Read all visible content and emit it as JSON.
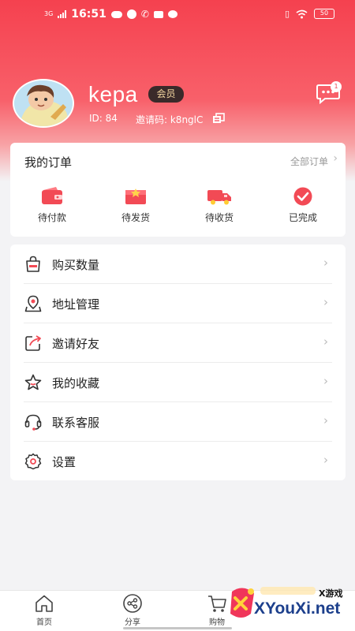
{
  "status_bar": {
    "network": "3G",
    "time": "16:51",
    "battery": "50"
  },
  "profile": {
    "username": "kepa",
    "badge": "会员",
    "id_label": "ID: 84",
    "invite_label": "邀请码: k8nglC",
    "message_count": "1"
  },
  "orders": {
    "title": "我的订单",
    "all_label": "全部订单",
    "items": [
      {
        "label": "待付款",
        "icon": "wallet-icon"
      },
      {
        "label": "待发货",
        "icon": "gift-box-icon"
      },
      {
        "label": "待收货",
        "icon": "delivery-truck-icon"
      },
      {
        "label": "已完成",
        "icon": "check-circle-icon"
      }
    ]
  },
  "menu": {
    "items": [
      {
        "label": "购买数量",
        "icon": "shopping-bag-icon"
      },
      {
        "label": "地址管理",
        "icon": "location-pin-icon"
      },
      {
        "label": "邀请好友",
        "icon": "share-arrow-icon"
      },
      {
        "label": "我的收藏",
        "icon": "star-icon"
      },
      {
        "label": "联系客服",
        "icon": "headset-icon"
      },
      {
        "label": "设置",
        "icon": "gear-icon"
      }
    ]
  },
  "tabbar": {
    "items": [
      {
        "label": "首页",
        "icon": "home-icon"
      },
      {
        "label": "分享",
        "icon": "share-icon"
      },
      {
        "label": "购物",
        "icon": "cart-icon"
      }
    ]
  },
  "watermark": {
    "top_text": "X游戏",
    "main_text": "XYouXi.net"
  },
  "colors": {
    "brand_red": "#f5414f",
    "badge_dark": "#3a2a2a",
    "badge_gold": "#f4d7a0"
  }
}
